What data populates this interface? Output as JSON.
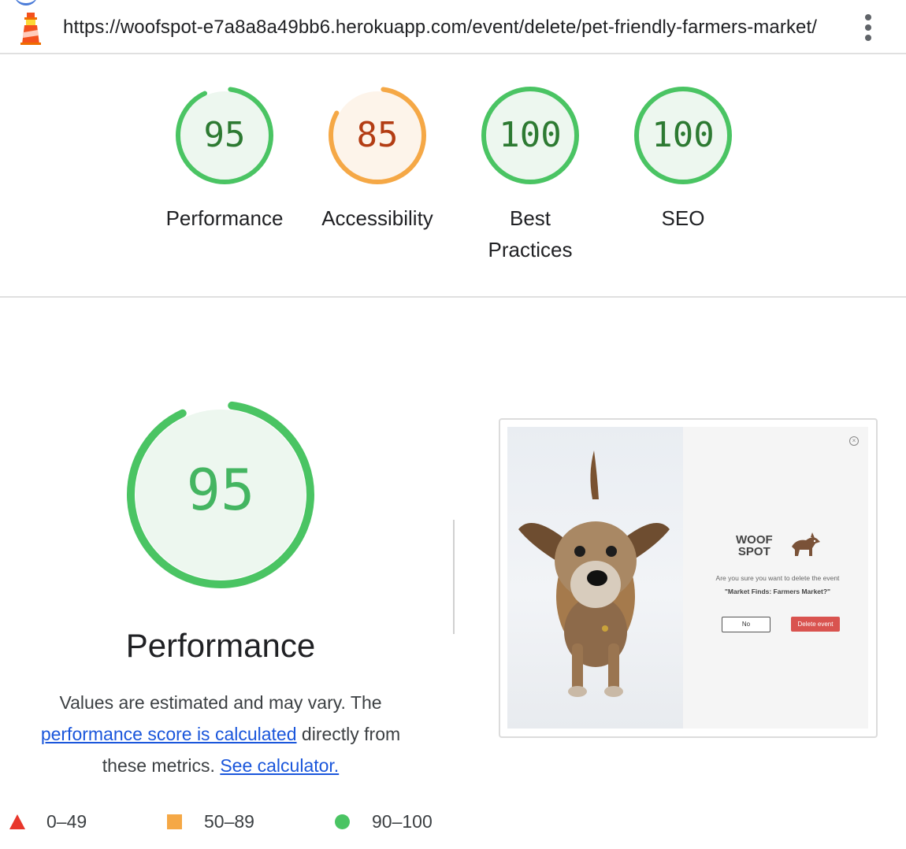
{
  "header": {
    "url": "https://woofspot-e7a8a8a49bb6.herokuapp.com/event/delete/pet-friendly-farmers-market/",
    "icon": "lighthouse-icon",
    "menu_icon": "kebab-menu-icon"
  },
  "categories": [
    {
      "id": "performance",
      "label": "Performance",
      "score": "95",
      "fraction": 0.95,
      "status": "pass"
    },
    {
      "id": "accessibility",
      "label": "Accessibility",
      "score": "85",
      "fraction": 0.85,
      "status": "average"
    },
    {
      "id": "best-practices",
      "label_line1": "Best",
      "label_line2": "Practices",
      "score": "100",
      "fraction": 1.0,
      "status": "pass"
    },
    {
      "id": "seo",
      "label": "SEO",
      "score": "100",
      "fraction": 1.0,
      "status": "pass"
    }
  ],
  "performance_section": {
    "score": "95",
    "fraction": 0.95,
    "title": "Performance",
    "desc_1": "Values are estimated and may vary. The",
    "link_1": "performance score is calculated",
    "desc_2": "directly from",
    "desc_3": "these metrics.",
    "link_2": "See calculator."
  },
  "screenshot": {
    "brand_line1": "WOOF",
    "brand_line2": "SPOT",
    "prompt": "Are you sure you want to delete the event",
    "event_name": "\"Market Finds: Farmers Market?\"",
    "no_label": "No",
    "delete_label": "Delete event",
    "close_icon": "close-icon"
  },
  "legend": [
    {
      "range": "0–49",
      "shape": "triangle",
      "color": "#e8362b"
    },
    {
      "range": "50–89",
      "shape": "square",
      "color": "#f5a846"
    },
    {
      "range": "90–100",
      "shape": "circle",
      "color": "#4ac463"
    }
  ],
  "colors": {
    "pass_stroke": "#4ac463",
    "pass_fill": "#edf7ef",
    "pass_text": "#2d7a32",
    "average_stroke": "#f5a846",
    "average_fill": "#fdf4ea",
    "average_text": "#b33d14",
    "big_text": "#44b561"
  }
}
